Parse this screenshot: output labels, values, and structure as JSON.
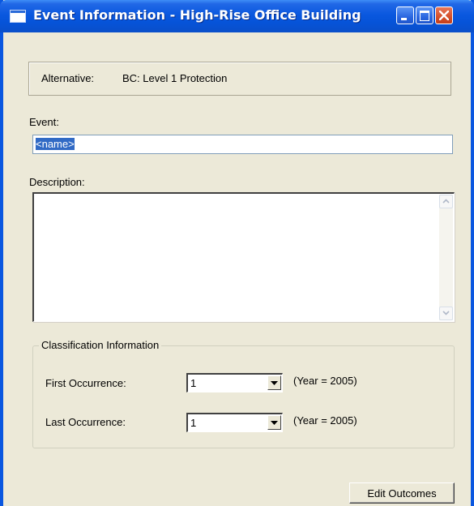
{
  "window": {
    "title": "Event Information - High-Rise Office Building",
    "controls": {
      "minimize_icon": "minimize-icon",
      "maximize_icon": "maximize-icon",
      "close_icon": "close-icon"
    }
  },
  "alternative": {
    "label": "Alternative:",
    "value": "BC: Level 1 Protection"
  },
  "event": {
    "label": "Event:",
    "value": "<name>"
  },
  "description": {
    "label": "Description:",
    "value": ""
  },
  "classification": {
    "legend": "Classification Information",
    "first_occurrence": {
      "label": "First Occurrence:",
      "selected": "1",
      "year_note": "(Year = 2005)"
    },
    "last_occurrence": {
      "label": "Last Occurrence:",
      "selected": "1",
      "year_note": "(Year = 2005)"
    }
  },
  "buttons": {
    "edit_outcomes": "Edit Outcomes"
  },
  "colors": {
    "titlebar": "#0a58df",
    "window_bg": "#ece9d8",
    "selection": "#316ac5",
    "close_button": "#d4502a"
  }
}
